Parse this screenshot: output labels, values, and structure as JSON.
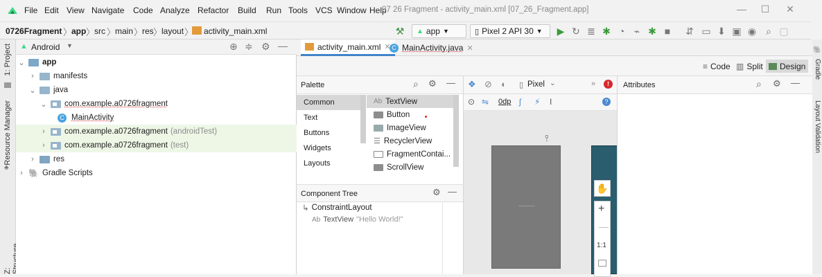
{
  "menubar": {
    "items": [
      "File",
      "Edit",
      "View",
      "Navigate",
      "Code",
      "Analyze",
      "Refactor",
      "Build",
      "Run",
      "Tools",
      "VCS",
      "Window",
      "Help"
    ],
    "window_title": "07 26 Fragment - activity_main.xml [07_26_Fragment.app]"
  },
  "navbar": {
    "breadcrumbs": [
      "0726Fragment",
      "app",
      "src",
      "main",
      "res",
      "layout",
      "activity_main.xml"
    ],
    "run_config": "app",
    "device": "Pixel 2 API 30"
  },
  "left_strip": {
    "project": "1: Project",
    "resource_manager": "Resource Manager",
    "structure": "Z: Structure"
  },
  "right_strip": {
    "gradle": "Gradle",
    "layout_validation": "Layout Validation"
  },
  "project": {
    "view_label": "Android",
    "tree": [
      {
        "label": "app",
        "extra": ""
      },
      {
        "label": "manifests",
        "extra": ""
      },
      {
        "label": "java",
        "extra": ""
      },
      {
        "label": "com.example.a0726fragment",
        "extra": ""
      },
      {
        "label": "MainActivity",
        "extra": ""
      },
      {
        "label": "com.example.a0726fragment",
        "extra": "(androidTest)"
      },
      {
        "label": "com.example.a0726fragment",
        "extra": "(test)"
      },
      {
        "label": "res",
        "extra": ""
      },
      {
        "label": "Gradle Scripts",
        "extra": ""
      }
    ]
  },
  "editor": {
    "tabs": [
      "activity_main.xml",
      "MainActivity.java"
    ],
    "modes": [
      "Code",
      "Split",
      "Design"
    ]
  },
  "palette": {
    "title": "Palette",
    "categories": [
      "Common",
      "Text",
      "Buttons",
      "Widgets",
      "Layouts"
    ],
    "items": [
      "TextView",
      "Button",
      "ImageView",
      "RecyclerView",
      "FragmentContai...",
      "ScrollView"
    ],
    "textview_prefix": "Ab"
  },
  "component_tree": {
    "title": "Component Tree",
    "root": "ConstraintLayout",
    "child_type": "TextView",
    "child_text": "\"Hello World!\"",
    "child_prefix": "Ab"
  },
  "design_toolbar": {
    "device": "Pixel",
    "margin": "0dp"
  },
  "attributes": {
    "title": "Attributes"
  },
  "zoom": {
    "ratio": "1:1"
  }
}
